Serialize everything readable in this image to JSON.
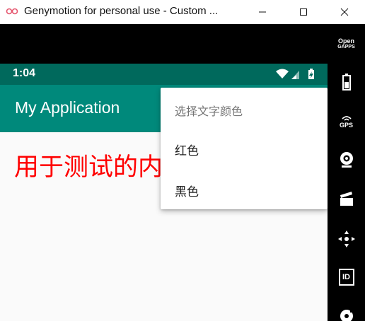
{
  "window": {
    "title": "Genymotion for personal use - Custom ...",
    "logo_icon": "genymotion-logo-icon",
    "controls": [
      "minimize-icon",
      "maximize-icon",
      "close-icon"
    ]
  },
  "status_bar": {
    "time": "1:04",
    "icons": [
      "wifi-icon",
      "cell-signal-icon",
      "battery-charging-icon"
    ]
  },
  "app_bar": {
    "title": "My Application"
  },
  "content": {
    "text": "用于测试的内",
    "text_color": "#ff0000"
  },
  "menu": {
    "header": "选择文字颜色",
    "items": [
      "红色",
      "黑色"
    ]
  },
  "side_toolbar": {
    "opengapps_line1": "Open",
    "opengapps_line2": "GAPPS",
    "gps_label": "GPS",
    "id_label": "ID",
    "icons": [
      "opengapps-icon",
      "battery-icon",
      "gps-icon",
      "webcam-icon",
      "media-clapperboard-icon",
      "dpad-icon",
      "identifiers-icon",
      "disk-icon"
    ]
  },
  "colors": {
    "status_bar": "#00695c",
    "app_bar": "#00897b",
    "accent_text": "#ff0000"
  }
}
